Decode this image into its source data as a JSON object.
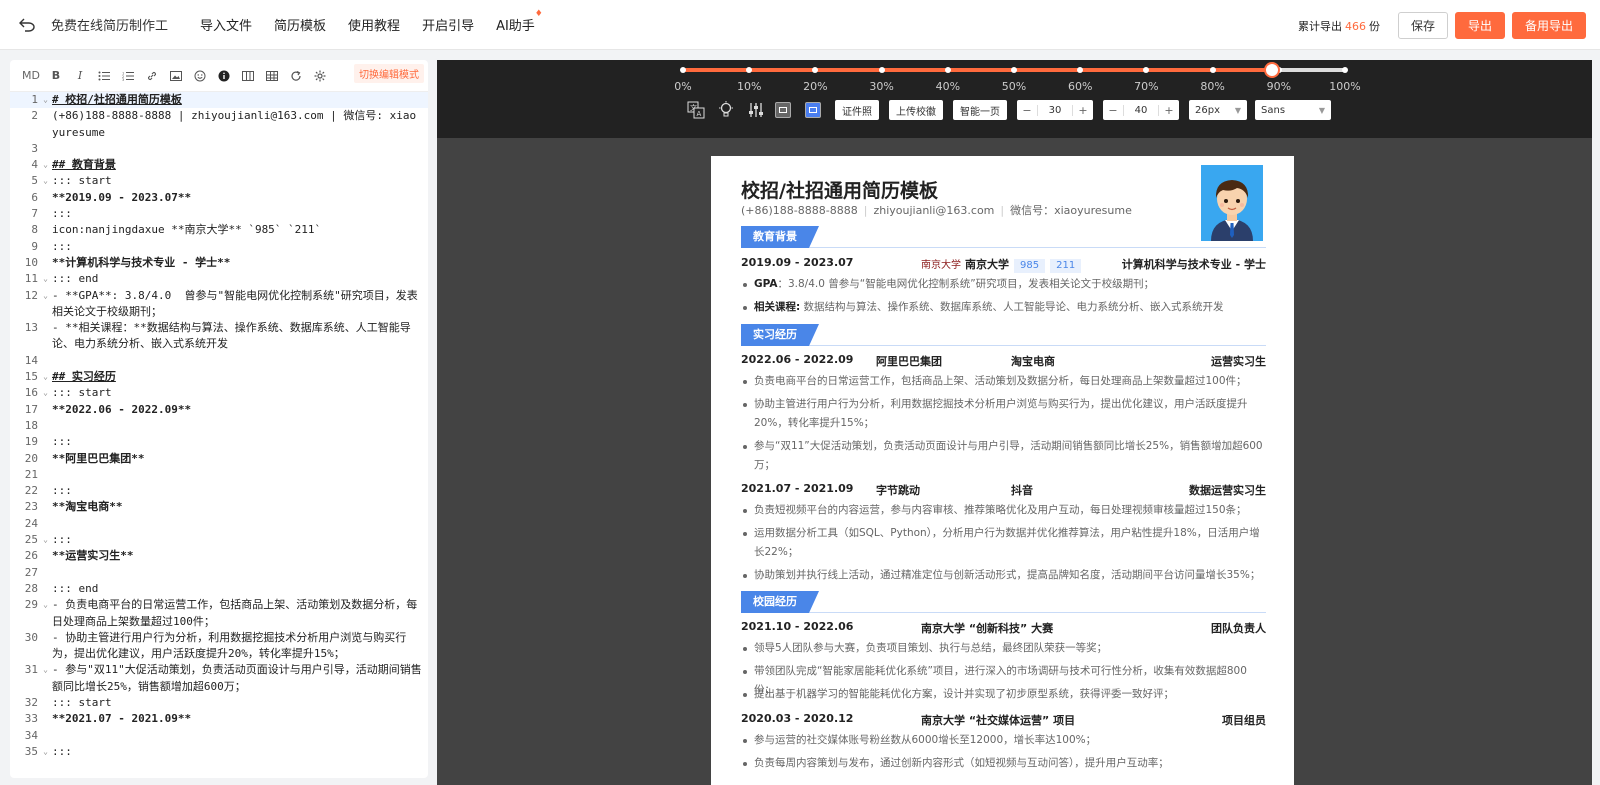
{
  "header": {
    "app_title": "免费在线简历制作工",
    "nav": [
      "导入文件",
      "简历模板",
      "使用教程",
      "开启引导",
      "AI助手"
    ],
    "export_prefix": "累计导出",
    "export_count": "466",
    "export_suffix": "份",
    "save_label": "保存",
    "export_label": "导出",
    "backup_export_label": "备用导出"
  },
  "editor": {
    "mode_label": "MD",
    "switch_mode_label": "切换编辑模式",
    "lines": [
      {
        "n": "1",
        "fold": true,
        "text": "# 校招/社招通用简历模板",
        "style": "h",
        "active": true
      },
      {
        "n": "2",
        "text": "(+86)188-8888-8888 | zhiyoujianli@163.com | 微信号: xiaoyuresume",
        "rows": 2
      },
      {
        "n": "3",
        "text": ""
      },
      {
        "n": "4",
        "fold": true,
        "text": "## 教育背景",
        "style": "h"
      },
      {
        "n": "5",
        "fold": true,
        "text": "::: start"
      },
      {
        "n": "6",
        "text": "**2019.09 - 2023.07**",
        "style": "b"
      },
      {
        "n": "7",
        "text": ":::"
      },
      {
        "n": "8",
        "text": "icon:nanjingdaxue **南京大学** `985` `211`"
      },
      {
        "n": "9",
        "text": ":::"
      },
      {
        "n": "10",
        "text": "**计算机科学与技术专业 - 学士**",
        "style": "b"
      },
      {
        "n": "11",
        "fold": true,
        "text": "::: end"
      },
      {
        "n": "12",
        "fold": true,
        "text": "- **GPA**: 3.8/4.0  曾参与\"智能电网优化控制系统\"研究项目，发表相关论文于校级期刊；",
        "rows": 2
      },
      {
        "n": "13",
        "text": "- **相关课程：**数据结构与算法、操作系统、数据库系统、人工智能导论、电力系统分析、嵌入式系统开发",
        "rows": 2
      },
      {
        "n": "14",
        "text": ""
      },
      {
        "n": "15",
        "fold": true,
        "text": "## 实习经历",
        "style": "h"
      },
      {
        "n": "16",
        "fold": true,
        "text": "::: start"
      },
      {
        "n": "17",
        "text": "**2022.06 - 2022.09**",
        "style": "b"
      },
      {
        "n": "18",
        "text": ""
      },
      {
        "n": "19",
        "text": ":::"
      },
      {
        "n": "20",
        "text": "**阿里巴巴集团**",
        "style": "b"
      },
      {
        "n": "21",
        "text": ""
      },
      {
        "n": "22",
        "text": ":::"
      },
      {
        "n": "23",
        "text": "**淘宝电商**",
        "style": "b"
      },
      {
        "n": "24",
        "text": ""
      },
      {
        "n": "25",
        "fold": true,
        "text": ":::"
      },
      {
        "n": "26",
        "text": "**运营实习生**",
        "style": "b"
      },
      {
        "n": "27",
        "text": ""
      },
      {
        "n": "28",
        "text": "::: end"
      },
      {
        "n": "29",
        "fold": true,
        "text": "- 负责电商平台的日常运营工作，包括商品上架、活动策划及数据分析，每日处理商品上架数量超过100件；",
        "rows": 2
      },
      {
        "n": "30",
        "text": "- 协助主管进行用户行为分析，利用数据挖掘技术分析用户浏览与购买行为，提出优化建议，用户活跃度提升20%，转化率提升15%；",
        "rows": 2
      },
      {
        "n": "31",
        "fold": true,
        "text": "- 参与\"双11\"大促活动策划，负责活动页面设计与用户引导，活动期间销售额同比增长25%，销售额增加超600万；",
        "rows": 2
      },
      {
        "n": "32",
        "text": "::: start"
      },
      {
        "n": "33",
        "text": "**2021.07 - 2021.09**",
        "style": "b"
      },
      {
        "n": "34",
        "text": ""
      },
      {
        "n": "35",
        "fold": true,
        "text": ":::"
      }
    ]
  },
  "preview": {
    "zoom_ticks": [
      "0%",
      "10%",
      "20%",
      "30%",
      "40%",
      "50%",
      "60%",
      "70%",
      "80%",
      "90%",
      "100%"
    ],
    "zoom_value": 0.89,
    "buttons": [
      "证件照",
      "上传校徽",
      "智能一页"
    ],
    "stepper1": "30",
    "stepper2": "40",
    "font_size": "26px",
    "font_family": "Sans"
  },
  "resume": {
    "title": "校招/社招通用简历模板",
    "phone": "(+86)188-8888-8888",
    "email": "zhiyoujianli@163.com",
    "wechat": "微信号：xiaoyuresume",
    "edu_tag": "教育背景",
    "edu_date": "2019.09 - 2023.07",
    "school_logo": "南京大学",
    "school": "南京大学",
    "badge1": "985",
    "badge2": "211",
    "major": "计算机科学与技术专业 - 学士",
    "gpa_label": "GPA",
    "gpa_text": "：3.8/4.0 曾参与“智能电网优化控制系统”研究项目，发表相关论文于校级期刊；",
    "course_label": "相关课程:",
    "course_text": " 数据结构与算法、操作系统、数据库系统、人工智能导论、电力系统分析、嵌入式系统开发",
    "intern_tag": "实习经历",
    "job1_date": "2022.06 - 2022.09",
    "job1_company": "阿里巴巴集团",
    "job1_dept": "淘宝电商",
    "job1_role": "运营实习生",
    "job1_b1": "负责电商平台的日常运营工作，包括商品上架、活动策划及数据分析，每日处理商品上架数量超过100件；",
    "job1_b2": "协助主管进行用户行为分析，利用数据挖掘技术分析用户浏览与购买行为，提出优化建议，用户活跃度提升20%，转化率提升15%；",
    "job1_b3": "参与“双11”大促活动策划，负责活动页面设计与用户引导，活动期间销售额同比增长25%，销售额增加超600万；",
    "job2_date": "2021.07 - 2021.09",
    "job2_company": "字节跳动",
    "job2_dept": "抖音",
    "job2_role": "数据运营实习生",
    "job2_b1": "负责短视频平台的内容运营，参与内容审核、推荐策略优化及用户互动，每日处理视频审核量超过150条；",
    "job2_b2": "运用数据分析工具（如SQL、Python），分析用户行为数据并优化推荐算法，用户粘性提升18%，日活用户增长22%；",
    "job2_b3": "协助策划并执行线上活动，通过精准定位与创新活动形式，提高品牌知名度，活动期间平台访问量增长35%；",
    "campus_tag": "校园经历",
    "camp1_date": "2021.10 - 2022.06",
    "camp1_name": "南京大学 “创新科技” 大赛",
    "camp1_role": "团队负责人",
    "camp1_b1": "领导5人团队参与大赛，负责项目策划、执行与总结，最终团队荣获一等奖；",
    "camp1_b2": "带领团队完成“智能家居能耗优化系统”项目，进行深入的市场调研与技术可行性分析，收集有效数据超800份；",
    "camp1_b3": "提出基于机器学习的智能能耗优化方案，设计并实现了初步原型系统，获得评委一致好评；",
    "camp2_date": "2020.03 - 2020.12",
    "camp2_name": "南京大学 “社交媒体运营” 项目",
    "camp2_role": "项目组员",
    "camp2_b1": "参与运营的社交媒体账号粉丝数从6000增长至12000，增长率达100%；",
    "camp2_b2": "负责每周内容策划与发布，通过创新内容形式（如短视频与互动问答），提升用户互动率；"
  }
}
